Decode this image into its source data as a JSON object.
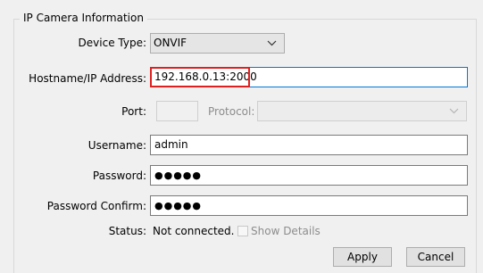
{
  "group": {
    "title": "IP Camera Information"
  },
  "fields": {
    "device_type": {
      "label": "Device Type:",
      "value": "ONVIF"
    },
    "hostname": {
      "label": "Hostname/IP Address:",
      "value": "192.168.0.13:2000"
    },
    "port": {
      "label": "Port:",
      "value": ""
    },
    "protocol": {
      "label": "Protocol:",
      "value": ""
    },
    "username": {
      "label": "Username:",
      "value": "admin"
    },
    "password": {
      "label": "Password:",
      "value": "●●●●●"
    },
    "password_confirm": {
      "label": "Password Confirm:",
      "value": "●●●●●"
    },
    "status": {
      "label": "Status:",
      "value": "Not connected."
    }
  },
  "show_details": {
    "label": "Show Details",
    "checked": false
  },
  "buttons": {
    "apply": "Apply",
    "cancel": "Cancel"
  },
  "icons": {
    "dropdown": "chevron-down-icon"
  },
  "colors": {
    "highlight": "#e02020",
    "focus_border": "#0078d7"
  }
}
